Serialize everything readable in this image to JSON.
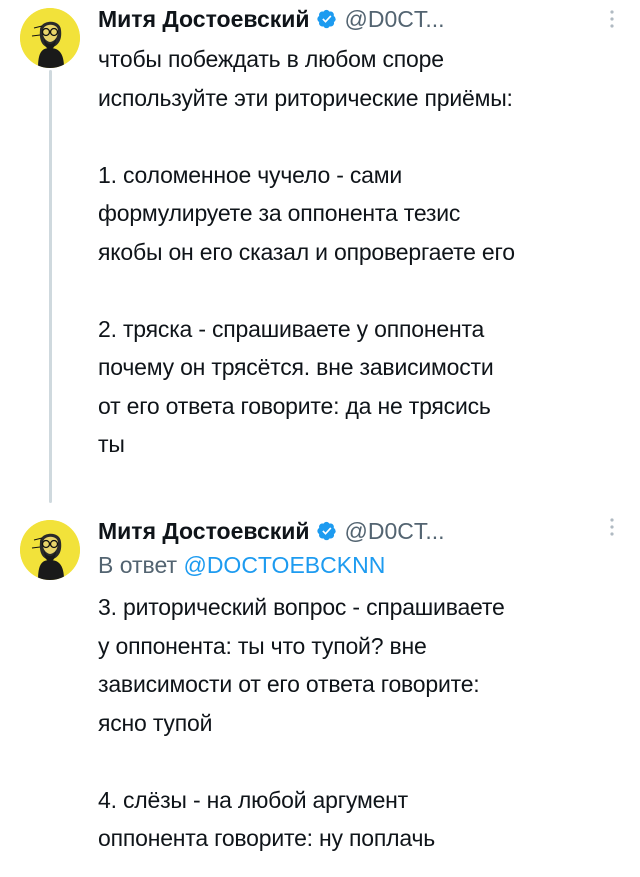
{
  "tweets": [
    {
      "author": {
        "display_name": "Митя Достоевский",
        "handle": "@D0CT..."
      },
      "text": "чтобы побеждать в любом споре\nиспользуйте эти риторические приёмы:\n\n1. соломенное чучело - сами\nформулируете за оппонента тезис\nякобы он его сказал и опровергаете его\n\n2. тряска - спрашиваете у оппонента\nпочему он трясётся. вне зависимости\nот его ответа говорите: да не трясись\nты"
    },
    {
      "author": {
        "display_name": "Митя Достоевский",
        "handle": "@D0CT..."
      },
      "reply_prefix": "В ответ",
      "reply_mention": "@DOCTOEBCKNN",
      "text": "3. риторический вопрос - спрашиваете\nу оппонента: ты что тупой? вне\nзависимости от его ответа говорите:\nясно тупой\n\n4. слёзы - на любой аргумент\nоппонента говорите: ну поплачь"
    }
  ],
  "colors": {
    "text": "#0f1419",
    "secondary": "#536471",
    "accent": "#1d9bf0",
    "avatar_bg": "#f2e23a",
    "thread_line": "#cfd9de"
  },
  "icons": {
    "verified": "verified-badge-icon",
    "more": "more-options-icon"
  }
}
